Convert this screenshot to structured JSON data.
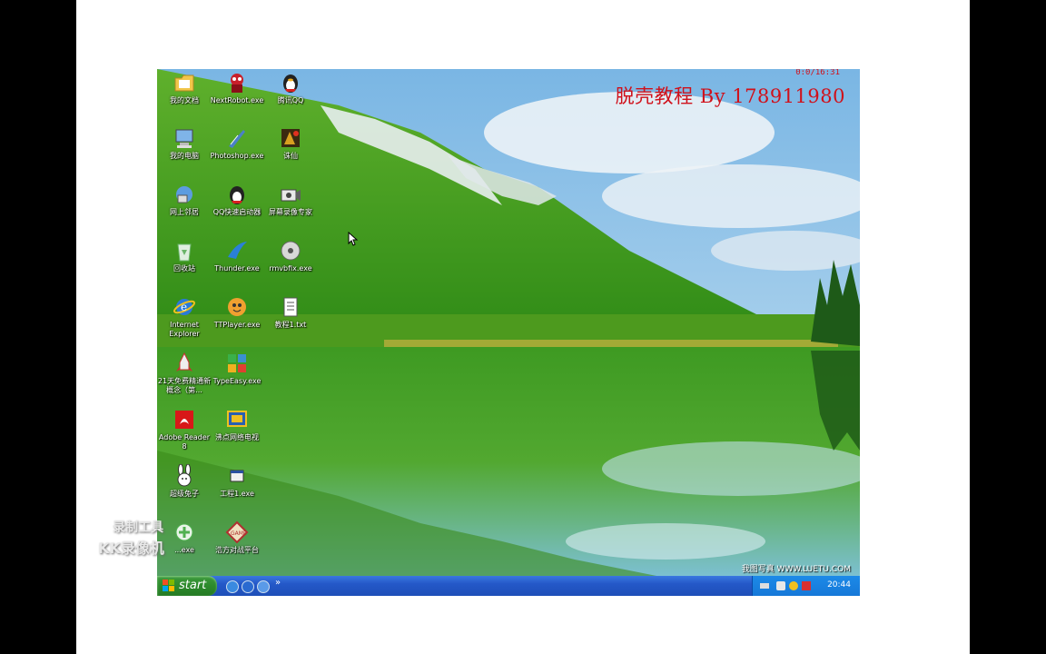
{
  "overlay": {
    "title": "脱壳教程 By 178911980",
    "timer": "0:0/16:31"
  },
  "desktop_icons": [
    {
      "id": "my-documents",
      "label": "我的文档",
      "icon": "folder-doc-icon",
      "color": "#f2c64a"
    },
    {
      "id": "nextrobot",
      "label": "NextRobot.exe",
      "icon": "robot-icon",
      "color": "#c8202a"
    },
    {
      "id": "tencent-qq",
      "label": "腾讯QQ",
      "icon": "penguin-icon",
      "color": "#222"
    },
    {
      "id": "my-computer",
      "label": "我的电脑",
      "icon": "computer-icon",
      "color": "#7fb4e8"
    },
    {
      "id": "photoshop",
      "label": "Photoshop.exe",
      "icon": "feather-icon",
      "color": "#4a80c8"
    },
    {
      "id": "zhuxian",
      "label": "诛仙",
      "icon": "game-icon",
      "color": "#d8a020"
    },
    {
      "id": "network",
      "label": "网上邻居",
      "icon": "network-icon",
      "color": "#5c9ce0"
    },
    {
      "id": "qq-launcher",
      "label": "QQ快速启动器",
      "icon": "penguin-icon",
      "color": "#d82020"
    },
    {
      "id": "screen-recorder",
      "label": "屏幕录像专家",
      "icon": "camera-icon",
      "color": "#606060"
    },
    {
      "id": "recycle-bin",
      "label": "回收站",
      "icon": "recycle-icon",
      "color": "#6ab46a"
    },
    {
      "id": "thunder",
      "label": "Thunder.exe",
      "icon": "bird-icon",
      "color": "#2a80d8"
    },
    {
      "id": "rmvbfix",
      "label": "rmvbfix.exe",
      "icon": "disc-icon",
      "color": "#c0c0c0"
    },
    {
      "id": "ie",
      "label": "Internet Explorer",
      "icon": "ie-icon",
      "color": "#2a7ad8"
    },
    {
      "id": "ttplayer",
      "label": "TTPlayer.exe",
      "icon": "player-icon",
      "color": "#f0a030"
    },
    {
      "id": "tutorial-txt",
      "label": "教程1.txt",
      "icon": "text-file-icon",
      "color": "#ffffff"
    },
    {
      "id": "english-21",
      "label": "21天免费精通新概念（第...",
      "icon": "rocket-icon",
      "color": "#c83030"
    },
    {
      "id": "typeeasy",
      "label": "TypeEasy.exe",
      "icon": "blocks-icon",
      "color": "#3a90d0"
    },
    {
      "id": "adobe-reader",
      "label": "Adobe Reader 8",
      "icon": "pdf-icon",
      "color": "#d81818"
    },
    {
      "id": "net-tv",
      "label": "沸点网络电视",
      "icon": "tv-icon",
      "color": "#f0c020"
    },
    {
      "id": "super-rabbit",
      "label": "超级兔子",
      "icon": "rabbit-icon",
      "color": "#ffffff"
    },
    {
      "id": "project1",
      "label": "工程1.exe",
      "icon": "window-icon",
      "color": "#e8e8e8"
    },
    {
      "id": "win-exe",
      "label": "...exe",
      "icon": "plus-icon",
      "color": "#50b050"
    },
    {
      "id": "haofang",
      "label": "浩方对战平台",
      "icon": "game-badge-icon",
      "color": "#b03030"
    }
  ],
  "taskbar": {
    "start_label": "start",
    "clock": "20:44",
    "quicklaunch": [
      "ie-icon",
      "media-icon",
      "desktop-icon"
    ],
    "chevron": "»"
  },
  "watermarks": {
    "photo_credit": "我图写真 WWW.LUETU.COM",
    "kk_line1": "录制工具",
    "kk_line2": "KK录像机"
  }
}
